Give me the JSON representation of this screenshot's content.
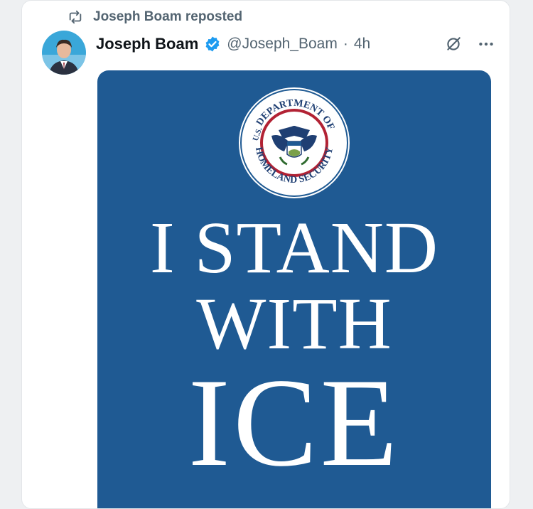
{
  "repost": {
    "text": "Joseph Boam reposted",
    "icon": "repost-icon"
  },
  "author": {
    "name": "Joseph Boam",
    "handle": "@Joseph_Boam",
    "separator": "·",
    "time": "4h",
    "verified": true,
    "verified_color": "#1d9bf0"
  },
  "actions": {
    "grok_icon": "grok-icon",
    "more_icon": "more-icon"
  },
  "image": {
    "background": "#1f5a93",
    "seal_text_top": "DEPARTMENT OF",
    "seal_text_left": "U.S.",
    "seal_text_bottom": "HOMELAND SECURITY",
    "line1": "I STAND",
    "line2": "WITH",
    "line3": "ICE"
  }
}
